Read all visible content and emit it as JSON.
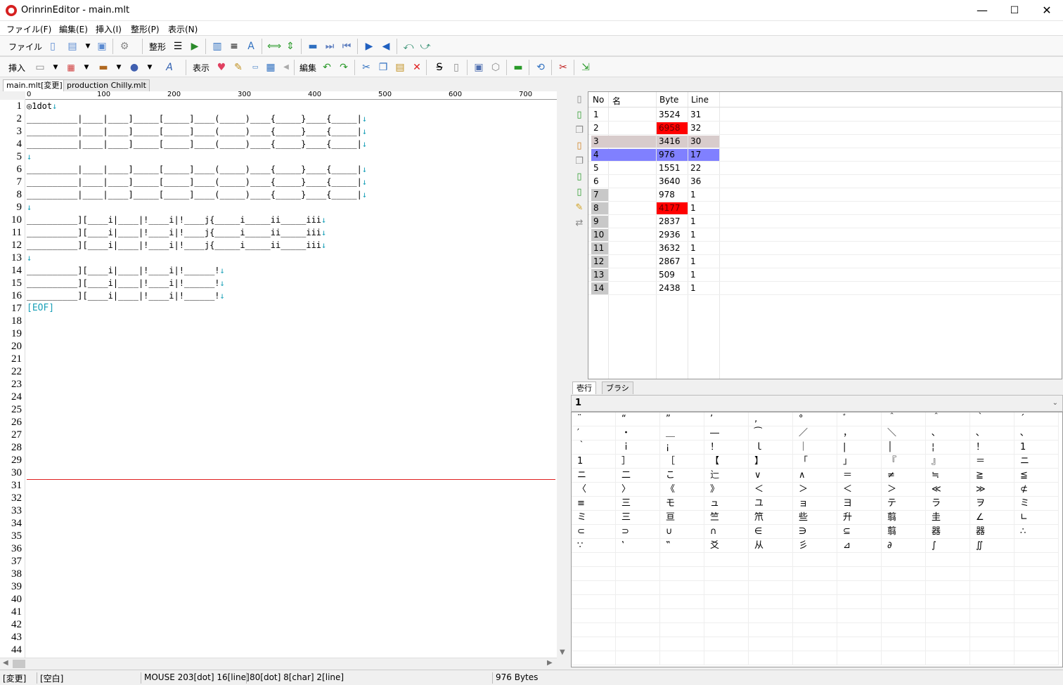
{
  "window": {
    "title": "OrinrinEditor - main.mlt",
    "minimize": "—",
    "maximize": "☐",
    "close": "✕"
  },
  "menu": [
    "ファイル(F)",
    "編集(E)",
    "挿入(I)",
    "整形(P)",
    "表示(N)"
  ],
  "toolbar1": {
    "file_label": "ファイル",
    "format_label": "整形"
  },
  "toolbar2": {
    "insert_label": "挿入",
    "view_label": "表示",
    "edit_label": "編集"
  },
  "tabs": [
    "main.mlt[変更]",
    "production Chilly.mlt"
  ],
  "ruler": [
    "0",
    "100",
    "200",
    "300",
    "400",
    "500",
    "600",
    "700"
  ],
  "editor": {
    "line_numbers": [
      "1",
      "2",
      "3",
      "4",
      "5",
      "6",
      "7",
      "8",
      "9",
      "10",
      "11",
      "12",
      "13",
      "14",
      "15",
      "16",
      "17",
      "18",
      "19",
      "20",
      "21",
      "22",
      "23",
      "24",
      "25",
      "26",
      "27",
      "28",
      "29",
      "30",
      "31",
      "32",
      "33",
      "34",
      "35",
      "36",
      "37",
      "38",
      "39",
      "40",
      "41",
      "42",
      "43",
      "44"
    ],
    "lines": [
      "◎1dot",
      "__________|____|____]_____[_____]____(_____)____{_____}____{_____|",
      "__________|____|____]_____[_____]____(_____)____{_____}____{_____|",
      "__________|____|____]_____[_____]____(_____)____{_____}____{_____|",
      "",
      "__________|____|____]_____[_____]____(_____)____{_____}____{_____|",
      "__________|____|____]_____[_____]____(_____)____{_____}____{_____|",
      "__________|____|____]_____[_____]____(_____)____{_____}____{_____|",
      "",
      "__________][____i|____|!____i|!____j{_____i_____ii_____iii",
      "__________][____i|____|!____i|!____j{_____i_____ii_____iii",
      "__________][____i|____|!____i|!____j{_____i_____ii_____iii",
      "",
      "__________][____i|____|!____i|!______!",
      "__________][____i|____|!____i|!______!",
      "__________][____i|____|!____i|!______!"
    ],
    "newline_marker": "↓",
    "eof": "[EOF]"
  },
  "pagelist": {
    "columns": [
      "No",
      "名",
      "Byte",
      "Line"
    ],
    "rows": [
      {
        "no": "1",
        "byte": "3524",
        "line": "31"
      },
      {
        "no": "2",
        "byte": "6958",
        "line": "32"
      },
      {
        "no": "3",
        "byte": "3416",
        "line": "30"
      },
      {
        "no": "4",
        "byte": "976",
        "line": "17"
      },
      {
        "no": "5",
        "byte": "1551",
        "line": "22"
      },
      {
        "no": "6",
        "byte": "3640",
        "line": "36"
      },
      {
        "no": "7",
        "byte": "978",
        "line": "1"
      },
      {
        "no": "8",
        "byte": "4177",
        "line": "1"
      },
      {
        "no": "9",
        "byte": "2837",
        "line": "1"
      },
      {
        "no": "10",
        "byte": "2936",
        "line": "1"
      },
      {
        "no": "11",
        "byte": "3632",
        "line": "1"
      },
      {
        "no": "12",
        "byte": "2867",
        "line": "1"
      },
      {
        "no": "13",
        "byte": "509",
        "line": "1"
      },
      {
        "no": "14",
        "byte": "2438",
        "line": "1"
      }
    ]
  },
  "palette": {
    "tabs": [
      "壱行",
      "ブラシ"
    ],
    "selected": "1",
    "chars": [
      "¨",
      "“",
      "”",
      "’",
      "‚",
      "°",
      "ﾞ",
      "＾",
      "＾",
      "｀",
      "´",
      "′",
      "・",
      "＿",
      "―",
      "⁀",
      "／",
      "，",
      "＼",
      "､",
      "､",
      "､",
      "｀",
      "ｉ",
      "¡",
      "！",
      "ｌ",
      "｜",
      "|",
      "│",
      "¦",
      "！",
      "1",
      "1",
      "］",
      "［",
      "【",
      "】",
      "「",
      "」",
      "『",
      "』",
      "＝",
      "ニ",
      "ニ",
      "二",
      "こ",
      "辷",
      "∨",
      "∧",
      "＝",
      "≠",
      "≒",
      "≧",
      "≦",
      "〈",
      "〉",
      "《",
      "》",
      "＜",
      "＞",
      "＜",
      "＞",
      "≪",
      "≫",
      "⊄",
      "≡",
      "三",
      "モ",
      "ュ",
      "ユ",
      "ョ",
      "ヨ",
      "テ",
      "ラ",
      "ヲ",
      "ミ",
      "ミ",
      "三",
      "亘",
      "竺",
      "笊",
      "些",
      "升",
      "翦",
      "圭",
      "∠",
      "∟",
      "⊂",
      "⊃",
      "∪",
      "∩",
      "∈",
      "∋",
      "⊆",
      "翦",
      "器",
      "器",
      "∴",
      "∵",
      "‛",
      "‟",
      "爻",
      "从",
      "彡",
      "⊿",
      "∂",
      "∫",
      "∬"
    ]
  },
  "status": [
    "[変更]",
    "[空白]",
    "MOUSE 203[dot] 16[line]",
    "80[dot] 8[char] 2[line]",
    "976 Bytes"
  ],
  "colors": {
    "red_highlight": "#ff0000",
    "selected_row": "#8080ff",
    "row3": "#d8cccc",
    "marker": "#1aa0b8",
    "cursor_line": "#e02020"
  }
}
